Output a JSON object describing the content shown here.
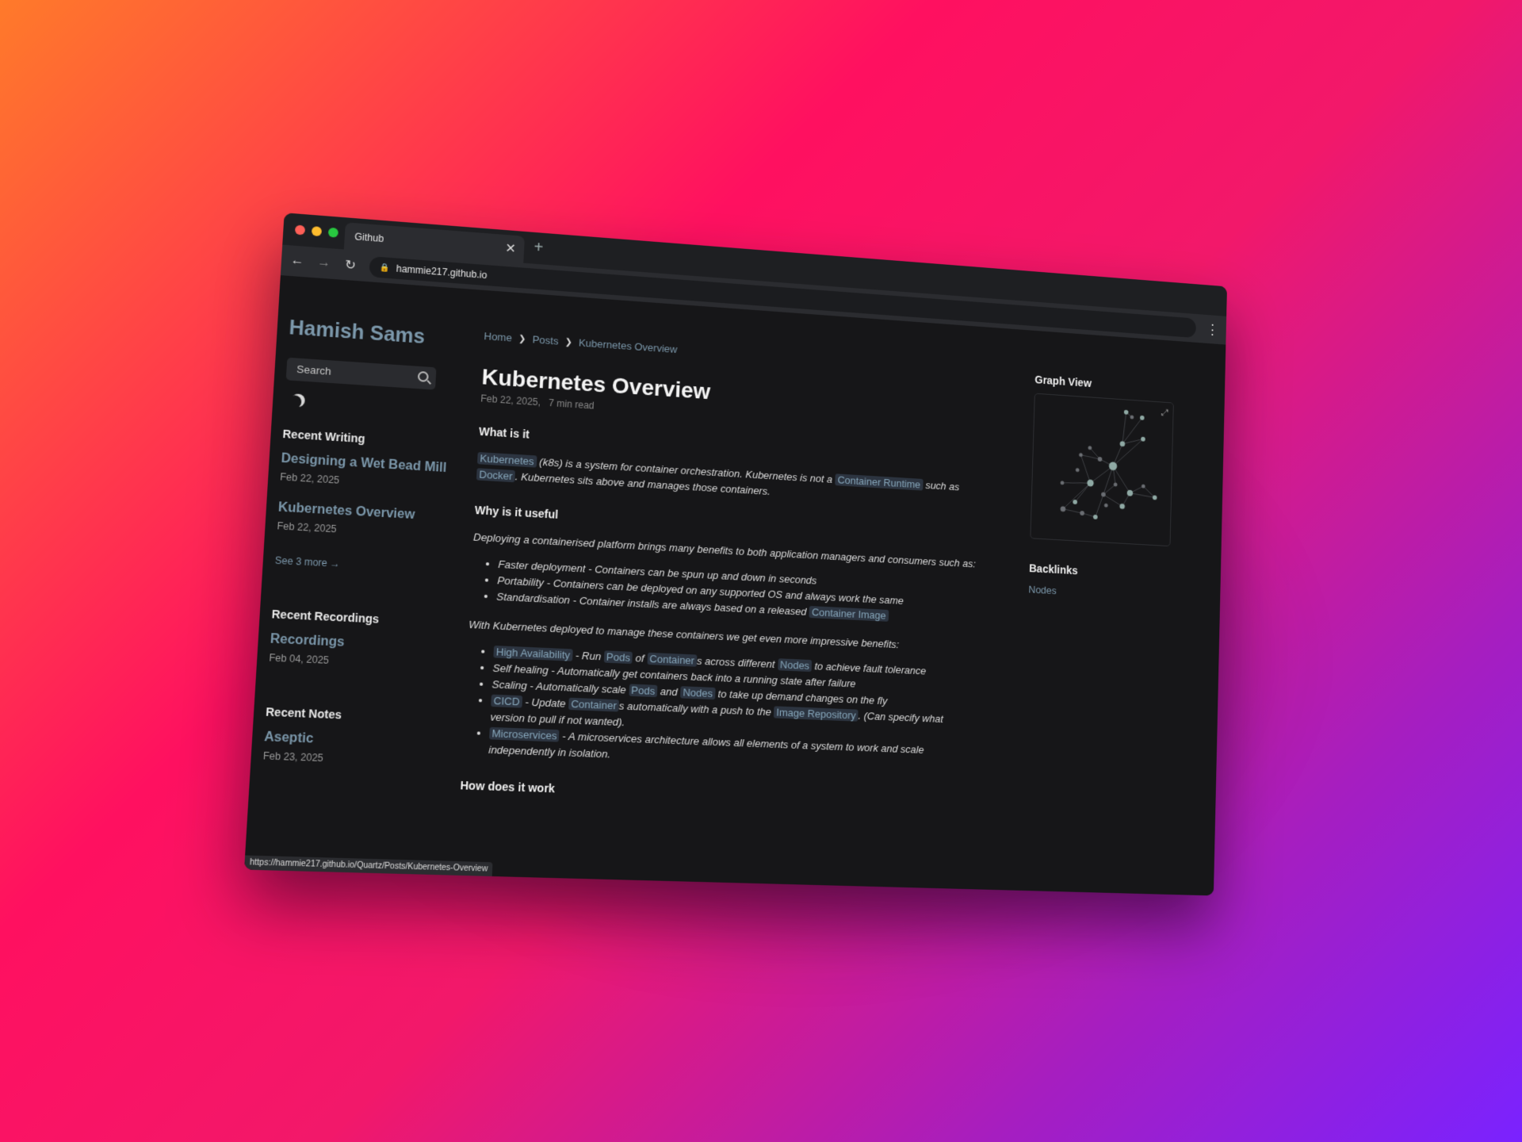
{
  "browser": {
    "tab_title": "Github",
    "tab_close": "✕",
    "new_tab": "+",
    "url": "hammie217.github.io",
    "status_url": "https://hammie217.github.io/Quartz/Posts/Kubernetes-Overview",
    "accent_colors": {
      "close": "#ff5f57",
      "minimize": "#febc2e",
      "maximize": "#28c840"
    }
  },
  "sidebar": {
    "site_title": "Hamish Sams",
    "search_placeholder": "Search",
    "recent_writing": {
      "heading": "Recent Writing",
      "items": [
        {
          "title": "Designing a Wet Bead Mill",
          "date": "Feb 22, 2025"
        },
        {
          "title": "Kubernetes Overview",
          "date": "Feb 22, 2025"
        }
      ],
      "see_more": "See 3 more →"
    },
    "recent_recordings": {
      "heading": "Recent Recordings",
      "items": [
        {
          "title": "Recordings",
          "date": "Feb 04, 2025"
        }
      ]
    },
    "recent_notes": {
      "heading": "Recent Notes",
      "items": [
        {
          "title": "Aseptic",
          "date": "Feb 23, 2025"
        }
      ]
    }
  },
  "breadcrumb": [
    "Home",
    "Posts",
    "Kubernetes Overview"
  ],
  "article": {
    "title": "Kubernetes Overview",
    "date": "Feb 22, 2025",
    "read_time": "7 min read",
    "what_heading": "What is it",
    "what_p": {
      "k8s": "Kubernetes",
      "t1": " (k8s) is a system for container orchestration. Kubernetes is not a ",
      "runtime": "Container Runtime",
      "t2": " such as ",
      "docker": "Docker",
      "t3": ". Kubernetes sits above and manages those containers."
    },
    "why_heading": "Why is it useful",
    "why_intro": "Deploying a containerised platform brings many benefits to both application managers and consumers such as:",
    "benefits": {
      "b1": "Faster deployment - Containers can be spun up and down in seconds",
      "b2": "Portability - Containers can be deployed on any supported OS and always work the same",
      "b3": "Standardisation - Container installs are always based on a released ",
      "b3_link": "Container Image"
    },
    "k8s_intro": "With Kubernetes deployed to manage these containers we get even more impressive benefits:",
    "k8s_benefits": {
      "ha": "High Availability",
      "ha_t1": " - Run ",
      "pods": "Pods",
      "of": " of ",
      "containers": "Container",
      "ha_t2": "s across different ",
      "nodes": "Nodes",
      "ha_t3": " to achieve fault tolerance",
      "self_healing": "Self healing - Automatically get containers back into a running state after failure",
      "scaling_t1": "Scaling - Automatically scale ",
      "and": " and ",
      "scaling_t2": " to take up demand changes on the fly",
      "cicd": "CICD",
      "cicd_t1": " - Update ",
      "cicd_t2": "s automatically with a push to the ",
      "image_repo": "Image Repository",
      "cicd_t3": ". (Can specify what version to pull if not wanted).",
      "micro": "Microservices",
      "micro_t": " - A microservices architecture allows all elements of a system to work and scale independently in isolation."
    },
    "how_heading": "How does it work"
  },
  "right": {
    "graph_heading": "Graph View",
    "backlinks_heading": "Backlinks",
    "backlinks": [
      "Nodes"
    ]
  }
}
